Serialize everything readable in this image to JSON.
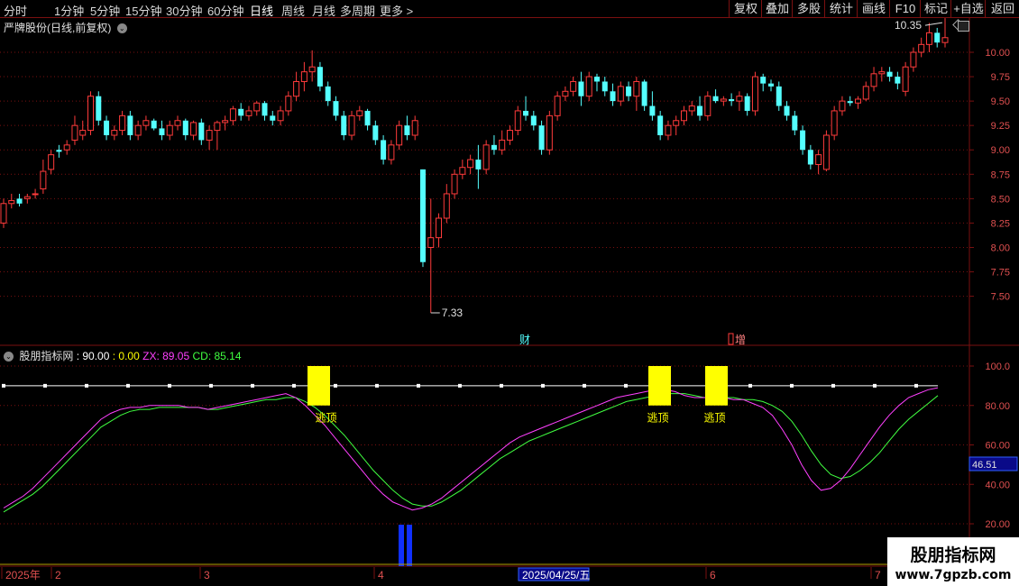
{
  "toolbar": {
    "periods": [
      "分时",
      "1分钟",
      "5分钟",
      "15分钟",
      "30分钟",
      "60分钟",
      "日线",
      "周线",
      "月线",
      "多周期",
      "更多 >"
    ],
    "active_period": "日线",
    "right_buttons": [
      "复权",
      "叠加",
      "多股",
      "统计",
      "画线",
      "F10",
      "标记",
      "+自选",
      "返回"
    ]
  },
  "price_panel": {
    "title": "严牌股份(日线,前复权)",
    "high_label": "10.35",
    "low_label": "7.33",
    "event_labels": [
      "财",
      "增"
    ],
    "yticks": [
      "10.00",
      "9.75",
      "9.50",
      "9.25",
      "9.00",
      "8.75",
      "8.50",
      "8.25",
      "8.00",
      "7.75",
      "7.50"
    ]
  },
  "indicator_panel": {
    "name": "股朋指标网",
    "line_value": ": 90.00",
    "zero_value": ": 0.00",
    "zx_label": "ZX: 89.05",
    "cd_label": "CD: 85.14",
    "signal_label": "逃顶",
    "current_marker": "46.51",
    "yticks": [
      "100.0",
      "80.00",
      "60.00",
      "40.00",
      "20.00"
    ]
  },
  "date_axis": {
    "labels": [
      "2025年",
      "2",
      "3",
      "4",
      "2025/04/25/五",
      "6",
      "7"
    ]
  },
  "watermark": {
    "line1": "股朋指标网",
    "line2": "www.7gpzb.com"
  },
  "colors": {
    "up": "#ff3b3b",
    "down": "#54ffff",
    "zx": "#ff40ff",
    "cd": "#40ff40",
    "signal": "#ffff00",
    "bottom_bar": "#1030ff",
    "grid": "#7a1010"
  },
  "chart_data": [
    {
      "type": "candlestick",
      "title": "严牌股份(日线,前复权)",
      "ylim": [
        7.2,
        10.5
      ],
      "ohlc": [
        [
          8.25,
          8.5,
          8.2,
          8.45
        ],
        [
          8.45,
          8.55,
          8.4,
          8.48
        ],
        [
          8.5,
          8.55,
          8.42,
          8.45
        ],
        [
          8.5,
          8.55,
          8.45,
          8.52
        ],
        [
          8.55,
          8.6,
          8.5,
          8.55
        ],
        [
          8.6,
          8.9,
          8.55,
          8.78
        ],
        [
          8.8,
          9.0,
          8.75,
          8.95
        ],
        [
          9.0,
          9.05,
          8.92,
          8.98
        ],
        [
          9.0,
          9.1,
          8.95,
          9.05
        ],
        [
          9.1,
          9.35,
          9.05,
          9.25
        ],
        [
          9.15,
          9.3,
          9.1,
          9.2
        ],
        [
          9.2,
          9.6,
          9.15,
          9.55
        ],
        [
          9.55,
          9.6,
          9.25,
          9.3
        ],
        [
          9.3,
          9.35,
          9.1,
          9.15
        ],
        [
          9.15,
          9.25,
          9.1,
          9.2
        ],
        [
          9.2,
          9.4,
          9.15,
          9.35
        ],
        [
          9.35,
          9.4,
          9.1,
          9.15
        ],
        [
          9.15,
          9.3,
          9.1,
          9.25
        ],
        [
          9.25,
          9.35,
          9.2,
          9.3
        ],
        [
          9.3,
          9.32,
          9.2,
          9.22
        ],
        [
          9.22,
          9.3,
          9.1,
          9.15
        ],
        [
          9.15,
          9.3,
          9.1,
          9.25
        ],
        [
          9.25,
          9.35,
          9.2,
          9.3
        ],
        [
          9.3,
          9.32,
          9.1,
          9.15
        ],
        [
          9.15,
          9.3,
          9.1,
          9.28
        ],
        [
          9.28,
          9.32,
          9.05,
          9.1
        ],
        [
          9.1,
          9.25,
          9.0,
          9.2
        ],
        [
          9.2,
          9.3,
          9.0,
          9.28
        ],
        [
          9.28,
          9.35,
          9.2,
          9.3
        ],
        [
          9.3,
          9.45,
          9.25,
          9.42
        ],
        [
          9.42,
          9.48,
          9.3,
          9.35
        ],
        [
          9.35,
          9.45,
          9.3,
          9.4
        ],
        [
          9.4,
          9.5,
          9.35,
          9.48
        ],
        [
          9.48,
          9.5,
          9.3,
          9.35
        ],
        [
          9.35,
          9.4,
          9.25,
          9.3
        ],
        [
          9.3,
          9.45,
          9.25,
          9.4
        ],
        [
          9.4,
          9.6,
          9.35,
          9.55
        ],
        [
          9.55,
          9.8,
          9.5,
          9.7
        ],
        [
          9.7,
          9.9,
          9.6,
          9.8
        ],
        [
          9.8,
          10.02,
          9.7,
          9.85
        ],
        [
          9.85,
          9.9,
          9.6,
          9.65
        ],
        [
          9.65,
          9.7,
          9.45,
          9.5
        ],
        [
          9.5,
          9.55,
          9.3,
          9.35
        ],
        [
          9.35,
          9.4,
          9.1,
          9.15
        ],
        [
          9.15,
          9.4,
          9.1,
          9.35
        ],
        [
          9.35,
          9.45,
          9.3,
          9.4
        ],
        [
          9.4,
          9.42,
          9.2,
          9.25
        ],
        [
          9.25,
          9.3,
          9.05,
          9.1
        ],
        [
          9.1,
          9.15,
          8.85,
          8.9
        ],
        [
          8.9,
          9.1,
          8.85,
          9.05
        ],
        [
          9.05,
          9.3,
          9.0,
          9.25
        ],
        [
          9.25,
          9.35,
          9.1,
          9.15
        ],
        [
          9.15,
          9.35,
          9.1,
          9.3
        ],
        [
          8.8,
          8.8,
          7.8,
          7.85
        ],
        [
          8.0,
          8.5,
          7.33,
          8.1
        ],
        [
          8.1,
          8.35,
          8.0,
          8.3
        ],
        [
          8.3,
          8.65,
          8.25,
          8.55
        ],
        [
          8.55,
          8.8,
          8.5,
          8.75
        ],
        [
          8.75,
          8.9,
          8.7,
          8.82
        ],
        [
          8.82,
          8.95,
          8.75,
          8.9
        ],
        [
          8.9,
          9.05,
          8.6,
          8.8
        ],
        [
          8.8,
          9.1,
          8.75,
          9.05
        ],
        [
          9.05,
          9.15,
          8.95,
          9.0
        ],
        [
          9.0,
          9.2,
          8.95,
          9.1
        ],
        [
          9.1,
          9.25,
          9.05,
          9.2
        ],
        [
          9.2,
          9.45,
          9.15,
          9.4
        ],
        [
          9.4,
          9.55,
          9.3,
          9.35
        ],
        [
          9.35,
          9.4,
          9.2,
          9.25
        ],
        [
          9.25,
          9.3,
          8.95,
          9.0
        ],
        [
          9.0,
          9.4,
          8.95,
          9.35
        ],
        [
          9.35,
          9.6,
          9.3,
          9.55
        ],
        [
          9.55,
          9.65,
          9.5,
          9.6
        ],
        [
          9.6,
          9.75,
          9.55,
          9.7
        ],
        [
          9.7,
          9.8,
          9.45,
          9.55
        ],
        [
          9.55,
          9.8,
          9.5,
          9.75
        ],
        [
          9.75,
          9.78,
          9.6,
          9.7
        ],
        [
          9.7,
          9.75,
          9.55,
          9.6
        ],
        [
          9.6,
          9.68,
          9.45,
          9.5
        ],
        [
          9.5,
          9.7,
          9.45,
          9.65
        ],
        [
          9.65,
          9.7,
          9.5,
          9.55
        ],
        [
          9.55,
          9.75,
          9.4,
          9.7
        ],
        [
          9.7,
          9.72,
          9.4,
          9.45
        ],
        [
          9.45,
          9.6,
          9.3,
          9.35
        ],
        [
          9.35,
          9.4,
          9.1,
          9.15
        ],
        [
          9.15,
          9.3,
          9.1,
          9.25
        ],
        [
          9.25,
          9.35,
          9.15,
          9.3
        ],
        [
          9.3,
          9.45,
          9.25,
          9.4
        ],
        [
          9.4,
          9.5,
          9.35,
          9.45
        ],
        [
          9.45,
          9.55,
          9.3,
          9.35
        ],
        [
          9.35,
          9.6,
          9.3,
          9.55
        ],
        [
          9.55,
          9.62,
          9.48,
          9.5
        ],
        [
          9.5,
          9.55,
          9.45,
          9.52
        ],
        [
          9.52,
          9.58,
          9.45,
          9.5
        ],
        [
          9.5,
          9.6,
          9.4,
          9.55
        ],
        [
          9.55,
          9.58,
          9.35,
          9.4
        ],
        [
          9.4,
          9.8,
          9.35,
          9.75
        ],
        [
          9.75,
          9.78,
          9.6,
          9.68
        ],
        [
          9.68,
          9.72,
          9.6,
          9.65
        ],
        [
          9.65,
          9.7,
          9.4,
          9.45
        ],
        [
          9.45,
          9.5,
          9.3,
          9.35
        ],
        [
          9.35,
          9.4,
          9.15,
          9.2
        ],
        [
          9.2,
          9.25,
          8.95,
          9.0
        ],
        [
          9.0,
          9.05,
          8.8,
          8.85
        ],
        [
          8.85,
          9.0,
          8.75,
          8.95
        ],
        [
          8.8,
          9.2,
          8.78,
          9.15
        ],
        [
          9.15,
          9.45,
          9.1,
          9.4
        ],
        [
          9.4,
          9.55,
          9.35,
          9.5
        ],
        [
          9.5,
          9.55,
          9.45,
          9.48
        ],
        [
          9.48,
          9.55,
          9.42,
          9.52
        ],
        [
          9.52,
          9.7,
          9.5,
          9.65
        ],
        [
          9.65,
          9.85,
          9.6,
          9.78
        ],
        [
          9.78,
          9.85,
          9.7,
          9.8
        ],
        [
          9.8,
          9.85,
          9.7,
          9.75
        ],
        [
          9.75,
          9.8,
          9.62,
          9.68
        ],
        [
          9.6,
          9.9,
          9.55,
          9.85
        ],
        [
          9.85,
          10.05,
          9.8,
          10.0
        ],
        [
          10.0,
          10.15,
          9.95,
          10.08
        ],
        [
          10.08,
          10.3,
          10.0,
          10.2
        ],
        [
          10.2,
          10.25,
          10.05,
          10.1
        ],
        [
          10.1,
          10.35,
          10.05,
          10.15
        ]
      ]
    },
    {
      "type": "line",
      "title": "股朋指标网",
      "ylim": [
        10,
        100
      ],
      "series": [
        {
          "name": "ZX",
          "values": [
            28,
            31,
            34,
            38,
            43,
            48,
            53,
            58,
            63,
            68,
            73,
            76,
            78,
            79,
            79,
            80,
            80,
            80,
            80,
            79,
            79,
            78,
            79,
            80,
            81,
            82,
            83,
            84,
            85,
            86,
            84,
            80,
            75,
            70,
            64,
            58,
            52,
            46,
            40,
            35,
            31,
            29,
            27,
            28,
            30,
            33,
            37,
            41,
            45,
            49,
            53,
            57,
            61,
            64,
            66,
            68,
            70,
            72,
            74,
            76,
            78,
            80,
            82,
            84,
            85,
            86,
            87,
            88,
            88,
            87,
            85,
            84,
            84,
            84,
            84,
            83,
            83,
            81,
            79,
            75,
            68,
            60,
            50,
            42,
            37,
            38,
            42,
            48,
            55,
            62,
            69,
            75,
            80,
            84,
            86,
            88,
            89
          ]
        },
        {
          "name": "CD",
          "values": [
            26,
            29,
            32,
            35,
            39,
            44,
            49,
            54,
            59,
            64,
            69,
            72,
            75,
            77,
            78,
            78,
            79,
            79,
            79,
            79,
            79,
            78,
            78,
            79,
            80,
            81,
            82,
            83,
            83,
            84,
            84,
            82,
            79,
            75,
            70,
            65,
            59,
            53,
            47,
            42,
            37,
            33,
            30,
            29,
            29,
            31,
            34,
            37,
            41,
            45,
            49,
            53,
            56,
            59,
            62,
            64,
            66,
            68,
            70,
            72,
            74,
            76,
            78,
            80,
            82,
            83,
            84,
            85,
            86,
            86,
            86,
            85,
            84,
            84,
            84,
            84,
            83,
            83,
            82,
            80,
            77,
            72,
            65,
            57,
            50,
            45,
            43,
            44,
            47,
            51,
            56,
            62,
            68,
            73,
            77,
            81,
            85
          ]
        }
      ]
    }
  ]
}
